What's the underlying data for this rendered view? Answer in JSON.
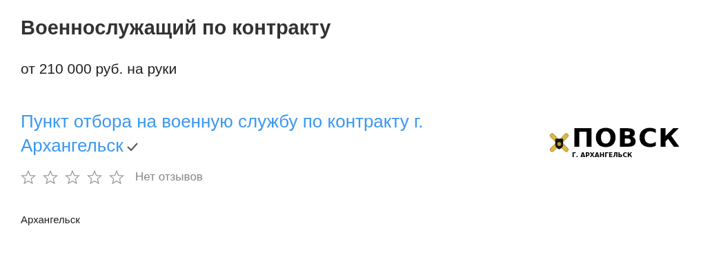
{
  "vacancy": {
    "title": "Военнослужащий по контракту",
    "salary": "от 210 000 руб. на руки"
  },
  "employer": {
    "name": "Пункт отбора на военную службу по контракту г. Архангельск",
    "verified": true,
    "stars": 0,
    "reviews": "Нет отзывов",
    "logo": {
      "title": "ПОВСК",
      "subtitle": "Г. АРХАНГЕЛЬСК"
    }
  },
  "location": "Архангельск"
}
